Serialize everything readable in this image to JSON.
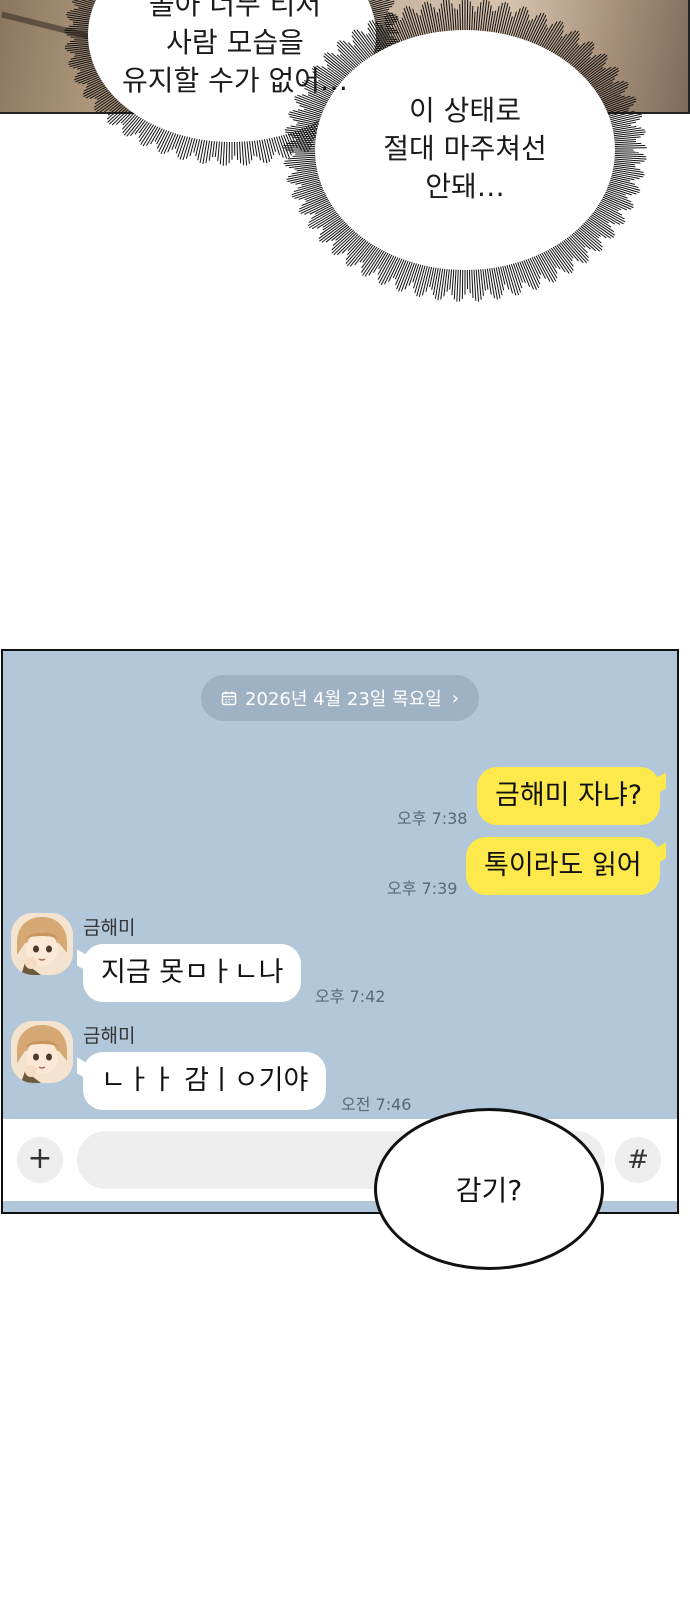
{
  "top_panel": {
    "bubble_1_text": "몰아 너무 티저\n사람 모습을\n유지할 수가 없어…",
    "bubble_2_text": "이 상태로\n절대 마주쳐선\n안돼…"
  },
  "chat": {
    "date_label": "2026년 4월 23일 목요일",
    "calendar_icon": "calendar-icon",
    "date_chevron": "›",
    "messages": [
      {
        "direction": "out",
        "text": "금해미 자냐?",
        "time": "오후 7:38"
      },
      {
        "direction": "out",
        "text": "톡이라도 읽어",
        "time": "오후 7:39"
      },
      {
        "direction": "in",
        "sender": "금해미",
        "text": "지금 못ㅁㅏㄴ나",
        "time": "오후 7:42"
      },
      {
        "direction": "in",
        "sender": "금해미",
        "text": "ㄴㅏㅏ 감ㅣㅇ기야",
        "time": "오전 7:46"
      }
    ],
    "input": {
      "plus_label": "+",
      "hash_label": "#",
      "placeholder": ""
    }
  },
  "overlay_bubble": {
    "text": "감기?"
  },
  "colors": {
    "chat_background": "#b2c7da",
    "outgoing_bubble": "#fde94b",
    "incoming_bubble": "#ffffff",
    "date_pill": "#9fb2c4"
  }
}
